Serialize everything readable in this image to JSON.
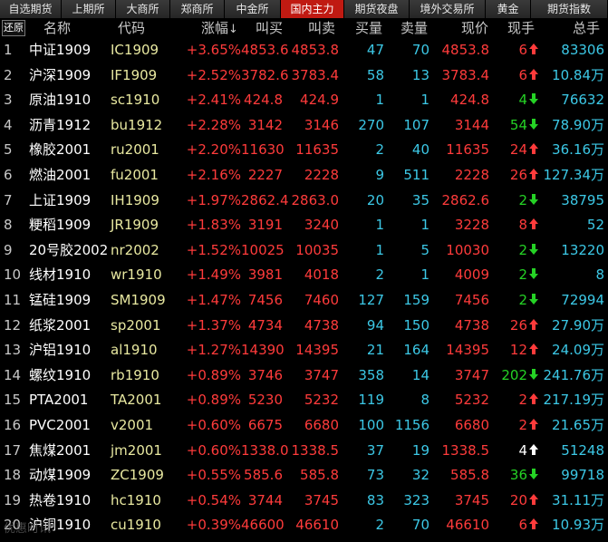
{
  "tabs": [
    "自选期货",
    "上期所",
    "大商所",
    "郑商所",
    "中金所",
    "国内主力",
    "期货夜盘",
    "境外交易所",
    "黄金",
    "期货指数"
  ],
  "active_tab": 5,
  "restore_label": "还原",
  "headers": {
    "name": "名称",
    "code": "代码",
    "change": "涨幅",
    "sort_icon": "↓",
    "bid": "叫买",
    "ask": "叫卖",
    "bidvol": "买量",
    "askvol": "卖量",
    "last": "现价",
    "cur": "现手",
    "total": "总手"
  },
  "rows": [
    {
      "idx": "1",
      "name": "中证1909",
      "code": "IC1909",
      "change": "+3.65%",
      "bid": "4853.6",
      "ask": "4853.8",
      "bidvol": "47",
      "askvol": "70",
      "last": "4853.8",
      "cur": "6",
      "dir": "up",
      "total": "83306"
    },
    {
      "idx": "2",
      "name": "沪深1909",
      "code": "IF1909",
      "change": "+2.52%",
      "bid": "3782.6",
      "ask": "3783.4",
      "bidvol": "58",
      "askvol": "13",
      "last": "3783.4",
      "cur": "6",
      "dir": "up",
      "total": "10.84万"
    },
    {
      "idx": "3",
      "name": "原油1910",
      "code": "sc1910",
      "change": "+2.41%",
      "bid": "424.8",
      "ask": "424.9",
      "bidvol": "1",
      "askvol": "1",
      "last": "424.8",
      "cur": "4",
      "dir": "down",
      "total": "76632"
    },
    {
      "idx": "4",
      "name": "沥青1912",
      "code": "bu1912",
      "change": "+2.28%",
      "bid": "3142",
      "ask": "3146",
      "bidvol": "270",
      "askvol": "107",
      "last": "3144",
      "cur": "54",
      "dir": "down",
      "total": "78.90万"
    },
    {
      "idx": "5",
      "name": "橡胶2001",
      "code": "ru2001",
      "change": "+2.20%",
      "bid": "11630",
      "ask": "11635",
      "bidvol": "2",
      "askvol": "40",
      "last": "11635",
      "cur": "24",
      "dir": "up",
      "total": "36.16万"
    },
    {
      "idx": "6",
      "name": "燃油2001",
      "code": "fu2001",
      "change": "+2.16%",
      "bid": "2227",
      "ask": "2228",
      "bidvol": "9",
      "askvol": "511",
      "last": "2228",
      "cur": "26",
      "dir": "up",
      "total": "127.34万"
    },
    {
      "idx": "7",
      "name": "上证1909",
      "code": "IH1909",
      "change": "+1.97%",
      "bid": "2862.4",
      "ask": "2863.0",
      "bidvol": "20",
      "askvol": "35",
      "last": "2862.6",
      "cur": "2",
      "dir": "down",
      "total": "38795"
    },
    {
      "idx": "8",
      "name": "粳稻1909",
      "code": "JR1909",
      "change": "+1.83%",
      "bid": "3191",
      "ask": "3240",
      "bidvol": "1",
      "askvol": "1",
      "last": "3228",
      "cur": "8",
      "dir": "up",
      "total": "52"
    },
    {
      "idx": "9",
      "name": "20号胶2002",
      "code": "nr2002",
      "change": "+1.52%",
      "bid": "10025",
      "ask": "10035",
      "bidvol": "1",
      "askvol": "5",
      "last": "10030",
      "cur": "2",
      "dir": "down",
      "total": "13220"
    },
    {
      "idx": "10",
      "name": "线材1910",
      "code": "wr1910",
      "change": "+1.49%",
      "bid": "3981",
      "ask": "4018",
      "bidvol": "2",
      "askvol": "1",
      "last": "4009",
      "cur": "2",
      "dir": "down",
      "total": "8"
    },
    {
      "idx": "11",
      "name": "锰硅1909",
      "code": "SM1909",
      "change": "+1.47%",
      "bid": "7456",
      "ask": "7460",
      "bidvol": "127",
      "askvol": "159",
      "last": "7456",
      "cur": "2",
      "dir": "down",
      "total": "72994"
    },
    {
      "idx": "12",
      "name": "纸浆2001",
      "code": "sp2001",
      "change": "+1.37%",
      "bid": "4734",
      "ask": "4738",
      "bidvol": "94",
      "askvol": "150",
      "last": "4738",
      "cur": "26",
      "dir": "up",
      "total": "27.90万"
    },
    {
      "idx": "13",
      "name": "沪铝1910",
      "code": "al1910",
      "change": "+1.27%",
      "bid": "14390",
      "ask": "14395",
      "bidvol": "21",
      "askvol": "164",
      "last": "14395",
      "cur": "12",
      "dir": "up",
      "total": "24.09万"
    },
    {
      "idx": "14",
      "name": "螺纹1910",
      "code": "rb1910",
      "change": "+0.89%",
      "bid": "3746",
      "ask": "3747",
      "bidvol": "358",
      "askvol": "14",
      "last": "3747",
      "cur": "202",
      "dir": "down",
      "total": "241.76万"
    },
    {
      "idx": "15",
      "name": "PTA2001",
      "code": "TA2001",
      "change": "+0.89%",
      "bid": "5230",
      "ask": "5232",
      "bidvol": "119",
      "askvol": "8",
      "last": "5232",
      "cur": "2",
      "dir": "up",
      "total": "217.19万"
    },
    {
      "idx": "16",
      "name": "PVC2001",
      "code": "v2001",
      "change": "+0.60%",
      "bid": "6675",
      "ask": "6680",
      "bidvol": "100",
      "askvol": "1156",
      "last": "6680",
      "cur": "2",
      "dir": "up",
      "total": "21.65万"
    },
    {
      "idx": "17",
      "name": "焦煤2001",
      "code": "jm2001",
      "change": "+0.60%",
      "bid": "1338.0",
      "ask": "1338.5",
      "bidvol": "37",
      "askvol": "19",
      "last": "1338.5",
      "cur": "4",
      "dir": "white",
      "total": "51248"
    },
    {
      "idx": "18",
      "name": "动煤1909",
      "code": "ZC1909",
      "change": "+0.55%",
      "bid": "585.6",
      "ask": "585.8",
      "bidvol": "73",
      "askvol": "32",
      "last": "585.8",
      "cur": "36",
      "dir": "down",
      "total": "99718"
    },
    {
      "idx": "19",
      "name": "热卷1910",
      "code": "hc1910",
      "change": "+0.54%",
      "bid": "3744",
      "ask": "3745",
      "bidvol": "83",
      "askvol": "323",
      "last": "3745",
      "cur": "20",
      "dir": "up",
      "total": "31.11万"
    },
    {
      "idx": "20",
      "name": "沪铜1910",
      "code": "cu1910",
      "change": "+0.39%",
      "bid": "46600",
      "ask": "46610",
      "bidvol": "2",
      "askvol": "70",
      "last": "46610",
      "cur": "6",
      "dir": "up",
      "total": "10.93万"
    }
  ],
  "watermark": "优惠时讯"
}
